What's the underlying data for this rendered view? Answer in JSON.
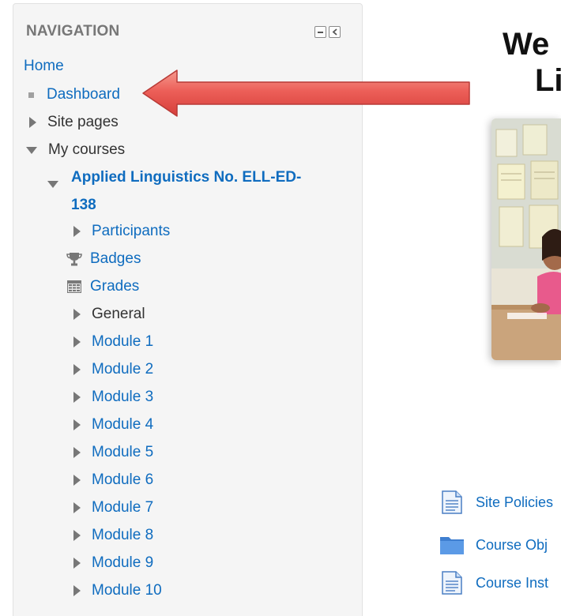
{
  "navigation": {
    "header": "NAVIGATION",
    "home": "Home",
    "dashboard": "Dashboard",
    "site_pages": "Site pages",
    "my_courses": "My courses",
    "course": {
      "title_line1": "Applied Linguistics No. ELL-ED-",
      "title_line2": "138",
      "participants": "Participants",
      "badges": "Badges",
      "grades": "Grades",
      "general": "General",
      "modules": [
        "Module 1",
        "Module 2",
        "Module 3",
        "Module 4",
        "Module 5",
        "Module 6",
        "Module 7",
        "Module 8",
        "Module 9",
        "Module 10"
      ]
    }
  },
  "main": {
    "heading_line1": "We",
    "heading_line2": "Li",
    "resources": [
      {
        "label": "Site Policies",
        "icon": "document-icon"
      },
      {
        "label": "Course Obj",
        "icon": "folder-icon"
      },
      {
        "label": "Course Inst",
        "icon": "document-icon"
      }
    ]
  },
  "colors": {
    "link": "#0f6cbf",
    "arrow": "#e8504e"
  }
}
